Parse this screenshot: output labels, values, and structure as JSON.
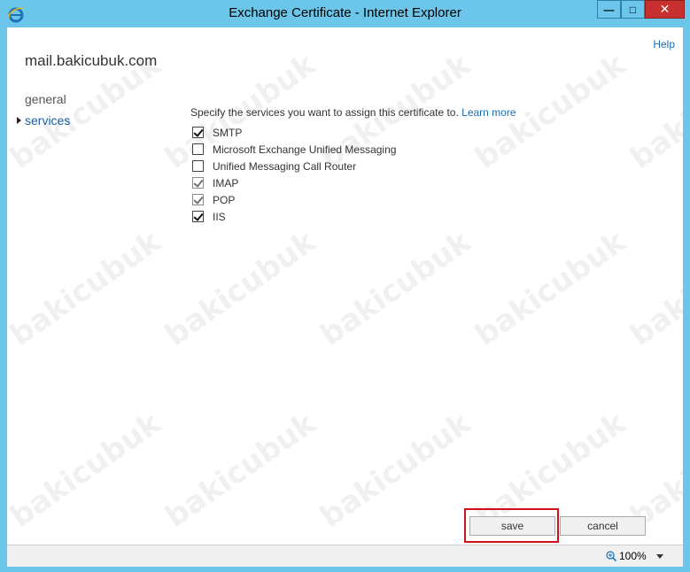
{
  "window": {
    "title": "Exchange Certificate - Internet Explorer",
    "min_glyph": "—",
    "max_glyph": "□",
    "close_glyph": "✕"
  },
  "page": {
    "help_label": "Help",
    "server_name": "mail.bakicubuk.com",
    "nav": {
      "general": "general",
      "services": "services"
    },
    "instruction": "Specify the services you want to assign this certificate to.",
    "learn_more": "Learn more",
    "services": [
      {
        "label": "SMTP",
        "checked": true,
        "disabled": false
      },
      {
        "label": "Microsoft Exchange Unified Messaging",
        "checked": false,
        "disabled": false
      },
      {
        "label": "Unified Messaging Call Router",
        "checked": false,
        "disabled": false
      },
      {
        "label": "IMAP",
        "checked": true,
        "disabled": true
      },
      {
        "label": "POP",
        "checked": true,
        "disabled": true
      },
      {
        "label": "IIS",
        "checked": true,
        "disabled": false
      }
    ],
    "buttons": {
      "save": "save",
      "cancel": "cancel"
    }
  },
  "statusbar": {
    "zoom": "100%"
  },
  "watermark": "bakicubuk",
  "colors": {
    "titlebar": "#6cc6ea",
    "link": "#1a6fb4",
    "highlight": "#d0111b"
  }
}
